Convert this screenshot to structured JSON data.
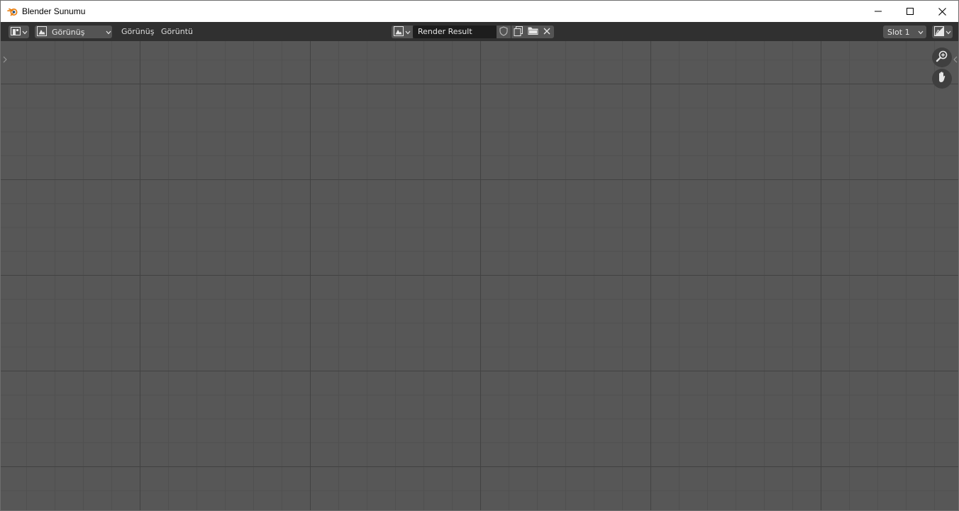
{
  "window": {
    "title": "Blender Sunumu",
    "controls": [
      "minimize-icon",
      "maximize-icon",
      "close-icon"
    ]
  },
  "header": {
    "editor_type_icon": "image-editor-icon",
    "mode_dropdown": {
      "icon": "image-icon",
      "label": "Görünüş"
    },
    "menus": [
      "Görünüş",
      "Görüntü"
    ],
    "image_browse_icon": "image-browse-icon",
    "image_name": "Render Result",
    "image_buttons": [
      "fake-user-shield-icon",
      "new-image-icon",
      "open-image-folder-icon",
      "unlink-close-icon"
    ],
    "slot": "Slot 1",
    "display_channels_icon": "display-channels-icon"
  },
  "canvas": {
    "tools": [
      "zoom-icon",
      "pan-hand-icon"
    ]
  },
  "colors": {
    "header_bg": "#303030",
    "canvas_bg": "#575757",
    "button_bg": "#545454",
    "field_bg": "#1d1d1d",
    "text": "#e6e6e6",
    "blender_orange": "#e87d0d"
  }
}
